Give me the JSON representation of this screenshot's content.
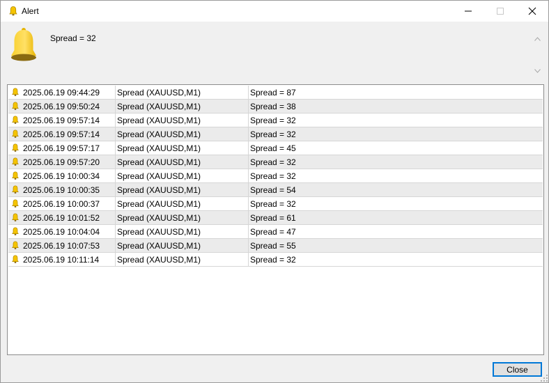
{
  "window": {
    "title": "Alert"
  },
  "header": {
    "message": "Spread = 32"
  },
  "alerts": [
    {
      "time": "2025.06.19 09:44:29",
      "source": "Spread (XAUUSD,M1)",
      "message": "Spread = 87"
    },
    {
      "time": "2025.06.19 09:50:24",
      "source": "Spread (XAUUSD,M1)",
      "message": "Spread = 38"
    },
    {
      "time": "2025.06.19 09:57:14",
      "source": "Spread (XAUUSD,M1)",
      "message": "Spread = 32"
    },
    {
      "time": "2025.06.19 09:57:14",
      "source": "Spread (XAUUSD,M1)",
      "message": "Spread = 32"
    },
    {
      "time": "2025.06.19 09:57:17",
      "source": "Spread (XAUUSD,M1)",
      "message": "Spread = 45"
    },
    {
      "time": "2025.06.19 09:57:20",
      "source": "Spread (XAUUSD,M1)",
      "message": "Spread = 32"
    },
    {
      "time": "2025.06.19 10:00:34",
      "source": "Spread (XAUUSD,M1)",
      "message": "Spread = 32"
    },
    {
      "time": "2025.06.19 10:00:35",
      "source": "Spread (XAUUSD,M1)",
      "message": "Spread = 54"
    },
    {
      "time": "2025.06.19 10:00:37",
      "source": "Spread (XAUUSD,M1)",
      "message": "Spread = 32"
    },
    {
      "time": "2025.06.19 10:01:52",
      "source": "Spread (XAUUSD,M1)",
      "message": "Spread = 61"
    },
    {
      "time": "2025.06.19 10:04:04",
      "source": "Spread (XAUUSD,M1)",
      "message": "Spread = 47"
    },
    {
      "time": "2025.06.19 10:07:53",
      "source": "Spread (XAUUSD,M1)",
      "message": "Spread = 55"
    },
    {
      "time": "2025.06.19 10:11:14",
      "source": "Spread (XAUUSD,M1)",
      "message": "Spread = 32"
    }
  ],
  "buttons": {
    "close_label": "Close"
  },
  "icons": {
    "title": "bell-icon",
    "header": "bell-icon",
    "row": "bell-icon",
    "minimize": "minimize-icon",
    "maximize": "maximize-icon",
    "close": "close-icon"
  },
  "colors": {
    "bell_yellow": "#f5c400",
    "bell_dark": "#8a6a10",
    "accent": "#0078d7",
    "row_alt": "#ebebeb"
  }
}
